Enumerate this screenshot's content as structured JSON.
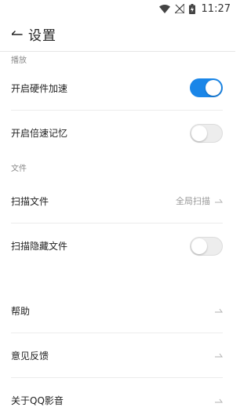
{
  "status_bar": {
    "time": "11:27",
    "icons": [
      "wifi-icon",
      "no-signal-icon",
      "battery-charging-icon"
    ]
  },
  "header": {
    "back_icon": "back-arrow-icon",
    "title": "设置"
  },
  "sections": {
    "playback": {
      "title": "播放",
      "items": [
        {
          "label": "开启硬件加速",
          "type": "toggle",
          "checked": true
        },
        {
          "label": "开启倍速记忆",
          "type": "toggle",
          "checked": false
        }
      ]
    },
    "file": {
      "title": "文件",
      "items": [
        {
          "label": "扫描文件",
          "type": "select",
          "value": "全局扫描"
        },
        {
          "label": "扫描隐藏文件",
          "type": "toggle",
          "checked": false
        }
      ]
    },
    "other": {
      "items": [
        {
          "label": "帮助",
          "type": "link"
        },
        {
          "label": "意见反馈",
          "type": "link"
        },
        {
          "label": "关于QQ影音",
          "type": "link"
        }
      ]
    }
  },
  "colors": {
    "accent": "#1a86e8",
    "toggle_off": "#ededed",
    "divider": "#ececec",
    "secondary_text": "#8a8a8a"
  }
}
